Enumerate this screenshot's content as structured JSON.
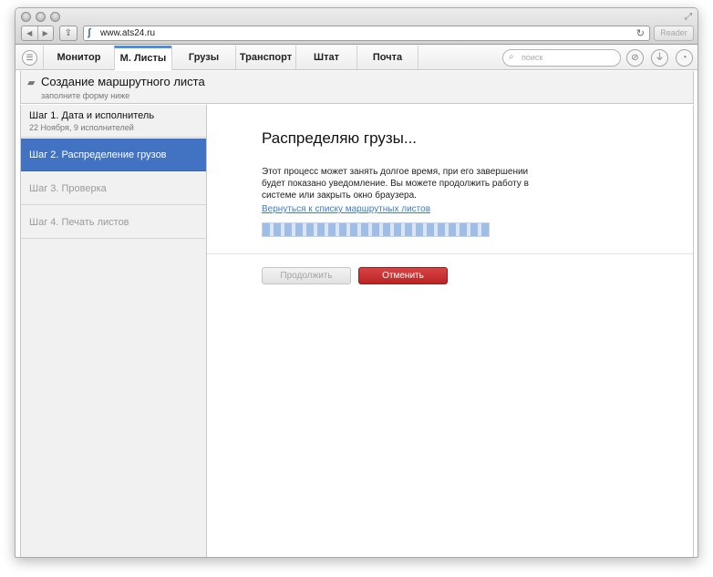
{
  "browser": {
    "url": "www.ats24.ru",
    "reader_label": "Reader",
    "back_glyph": "◀",
    "forward_glyph": "▶",
    "share_glyph": "⇪",
    "reload_glyph": "↻",
    "favicon_glyph": "ʃ",
    "fullscreen_glyph": "⤢"
  },
  "nav": {
    "menu_glyph": "☰",
    "tabs": [
      {
        "label": "Монитор",
        "active": false
      },
      {
        "label": "М. Листы",
        "active": true
      },
      {
        "label": "Грузы",
        "active": false
      },
      {
        "label": "Транспорт",
        "active": false
      },
      {
        "label": "Штат",
        "active": false
      },
      {
        "label": "Почта",
        "active": false
      }
    ],
    "search_placeholder": "поиск",
    "search_glyph": "⌕",
    "attach_glyph": "⊘",
    "filter_glyph": "⏚",
    "gauge_glyph": "◔"
  },
  "page": {
    "folder_glyph": "▰",
    "title": "Создание маршрутного листа",
    "subtitle": "заполните форму ниже"
  },
  "steps": [
    {
      "label": "Шаг 1. Дата и исполнитель",
      "sub": "22 Ноября, 9 исполнителей"
    },
    {
      "label": "Шаг 2. Распределение грузов"
    },
    {
      "label": "Шаг 3. Проверка"
    },
    {
      "label": "Шаг 4. Печать листов"
    }
  ],
  "main": {
    "heading": "Распределяю грузы...",
    "description": "Этот процесс может занять долгое время, при его завершении будет показано уведомление. Вы можете продолжить работу в системе или закрыть окно браузера.",
    "link": "Вернуться к списку маршрутных листов",
    "continue_label": "Продолжить",
    "cancel_label": "Отменить"
  },
  "colors": {
    "accent": "#4273c2",
    "cancel": "#c83232",
    "link": "#3e7ad0"
  }
}
